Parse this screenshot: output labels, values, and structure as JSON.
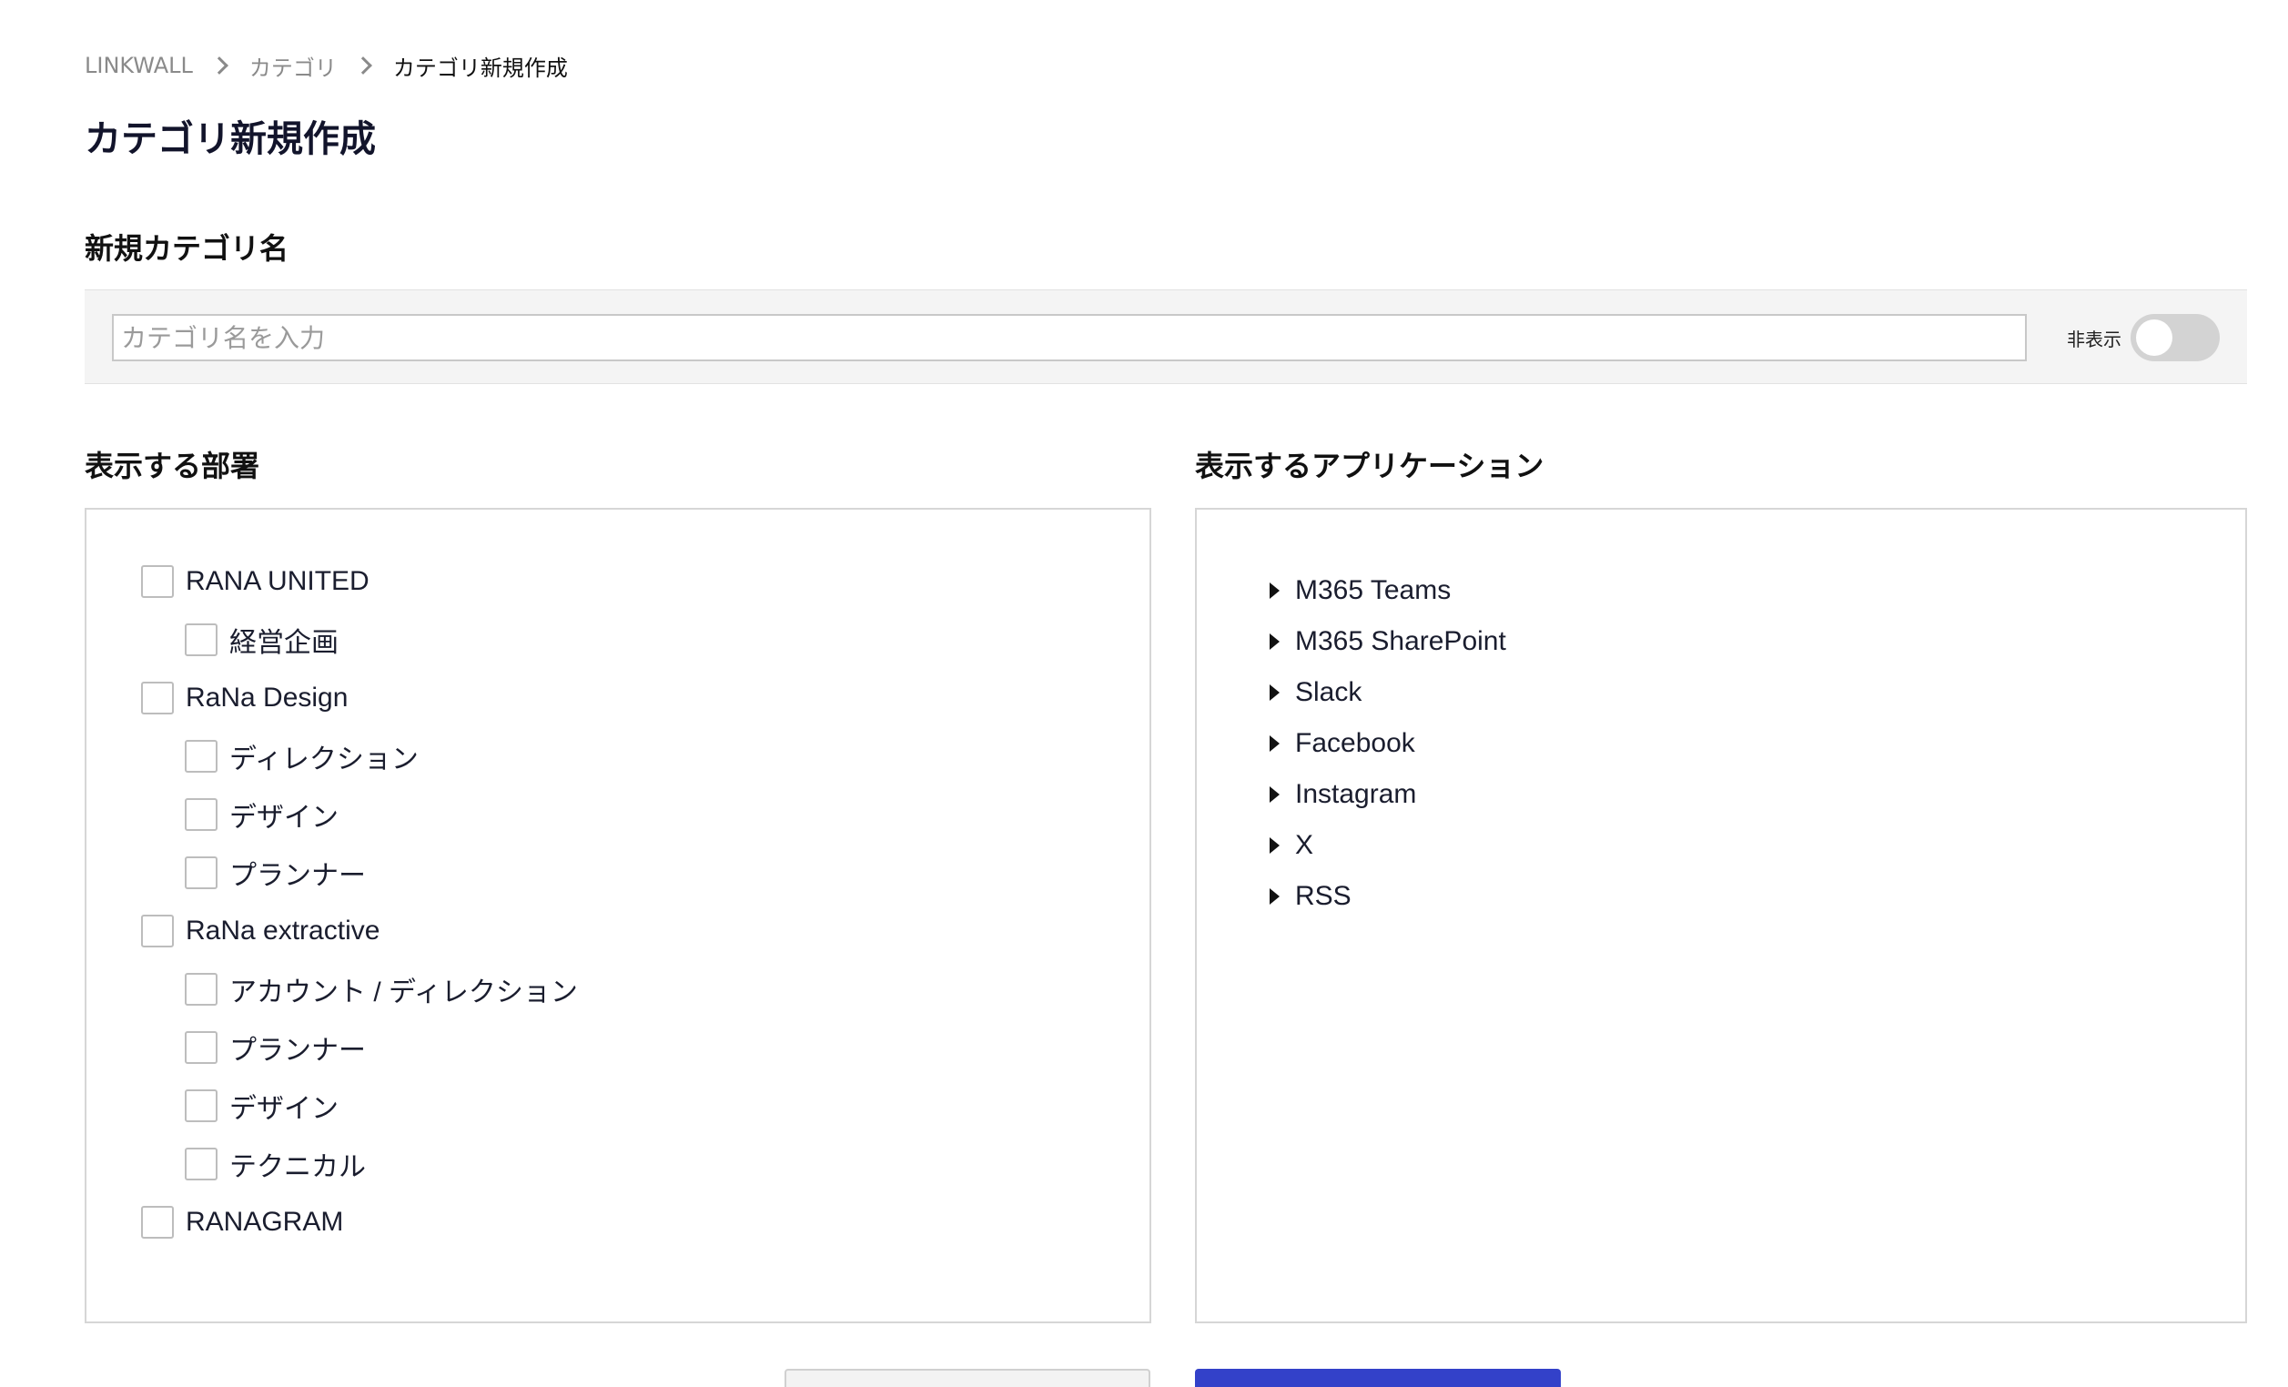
{
  "breadcrumb": {
    "root": "LINKWALL",
    "parent": "カテゴリ",
    "current": "カテゴリ新規作成"
  },
  "page_title": "カテゴリ新規作成",
  "name_section": {
    "label": "新規カテゴリ名",
    "placeholder": "カテゴリ名を入力",
    "value": "",
    "hidden_label": "非表示",
    "hidden_toggle_on": false
  },
  "departments": {
    "label": "表示する部署",
    "items": [
      {
        "label": "RANA UNITED",
        "level": 0,
        "checked": false
      },
      {
        "label": "経営企画",
        "level": 1,
        "checked": false
      },
      {
        "label": "RaNa Design",
        "level": 0,
        "checked": false
      },
      {
        "label": "ディレクション",
        "level": 1,
        "checked": false
      },
      {
        "label": "デザイン",
        "level": 1,
        "checked": false
      },
      {
        "label": "プランナー",
        "level": 1,
        "checked": false
      },
      {
        "label": "RaNa extractive",
        "level": 0,
        "checked": false
      },
      {
        "label": "アカウント / ディレクション",
        "level": 1,
        "checked": false
      },
      {
        "label": "プランナー",
        "level": 1,
        "checked": false
      },
      {
        "label": "デザイン",
        "level": 1,
        "checked": false
      },
      {
        "label": "テクニカル",
        "level": 1,
        "checked": false
      },
      {
        "label": "RANAGRAM",
        "level": 0,
        "checked": false
      }
    ]
  },
  "applications": {
    "label": "表示するアプリケーション",
    "items": [
      {
        "label": "M365 Teams"
      },
      {
        "label": "M365 SharePoint"
      },
      {
        "label": "Slack"
      },
      {
        "label": "Facebook"
      },
      {
        "label": "Instagram"
      },
      {
        "label": "X"
      },
      {
        "label": "RSS"
      }
    ]
  },
  "colors": {
    "primary": "#3341c9",
    "title": "#12142b",
    "panel_bg": "#f4f4f4",
    "toggle_off": "#d3d3d3"
  }
}
